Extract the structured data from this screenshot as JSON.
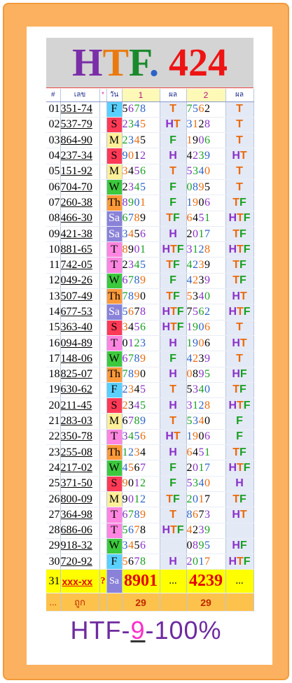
{
  "title": {
    "h": "H",
    "t": "T",
    "f": "F",
    "dot": ".",
    "num": "424"
  },
  "header": {
    "idx": "#",
    "code": "เลข",
    "star": "*",
    "day": "วัน",
    "col1": "1",
    "res1": "ผล",
    "col2": "2",
    "res2": "ผล"
  },
  "rows": [
    {
      "n": "01",
      "code": "351-74",
      "day": "F",
      "d1": "5",
      "n1": "678",
      "r1": "T",
      "n2": "7562",
      "d2": "",
      "r2": "T"
    },
    {
      "n": "02",
      "code": "537-79",
      "day": "S",
      "d1": "",
      "n1": "2345",
      "r1": "HT",
      "n2": "3128",
      "d2": "",
      "r2": "T"
    },
    {
      "n": "03",
      "code": "864-90",
      "day": "M",
      "d1": "",
      "n1": "2345",
      "r1": "F",
      "n2": "1906",
      "d2": "",
      "r2": "T"
    },
    {
      "n": "04",
      "code": "237-34",
      "day": "S",
      "d1": "",
      "n1": "9012",
      "r1": "H",
      "n2": "4239",
      "d2": "",
      "r2": "HT"
    },
    {
      "n": "05",
      "code": "151-92",
      "day": "M",
      "d1": "",
      "n1": "3456",
      "r1": "T",
      "n2": "5340",
      "d2": "",
      "r2": "T"
    },
    {
      "n": "06",
      "code": "704-70",
      "day": "W",
      "d1": "",
      "n1": "2345",
      "r1": "F",
      "n2": "0895",
      "d2": "",
      "r2": "T"
    },
    {
      "n": "07",
      "code": "260-38",
      "day": "Th",
      "d1": "",
      "n1": "8901",
      "r1": "F",
      "n2": "1906",
      "d2": "",
      "r2": "TF"
    },
    {
      "n": "08",
      "code": "466-30",
      "day": "Sa",
      "d1": "",
      "n1": "6789",
      "r1": "TF",
      "n2": "6451",
      "d2": "",
      "r2": "HTF"
    },
    {
      "n": "09",
      "code": "421-38",
      "day": "Sa",
      "d1": "",
      "n1": "3456",
      "r1": "H",
      "n2": "2017",
      "d2": "",
      "r2": "TF"
    },
    {
      "n": "10",
      "code": "881-65",
      "day": "T",
      "d1": "",
      "n1": "8901",
      "r1": "HTF",
      "n2": "3128",
      "d2": "",
      "r2": "HTF"
    },
    {
      "n": "11",
      "code": "742-05",
      "day": "T",
      "d1": "",
      "n1": "2345",
      "r1": "TF",
      "n2": "4239",
      "d2": "",
      "r2": "TF"
    },
    {
      "n": "12",
      "code": "049-26",
      "day": "W",
      "d1": "",
      "n1": "6789",
      "r1": "F",
      "n2": "4239",
      "d2": "",
      "r2": "TF"
    },
    {
      "n": "13",
      "code": "507-49",
      "day": "Th",
      "d1": "",
      "n1": "7890",
      "r1": "TF",
      "n2": "5340",
      "d2": "",
      "r2": "HT"
    },
    {
      "n": "14",
      "code": "677-53",
      "day": "Sa",
      "d1": "",
      "n1": "5678",
      "r1": "HTF",
      "n2": "7562",
      "d2": "",
      "r2": "HTF"
    },
    {
      "n": "15",
      "code": "363-40",
      "day": "S",
      "d1": "",
      "n1": "3456",
      "r1": "HTF",
      "n2": "1906",
      "d2": "",
      "r2": "T"
    },
    {
      "n": "16",
      "code": "094-89",
      "day": "T",
      "d1": "",
      "n1": "0123",
      "r1": "H",
      "n2": "1906",
      "d2": "",
      "r2": "HT"
    },
    {
      "n": "17",
      "code": "148-06",
      "day": "W",
      "d1": "",
      "n1": "6789",
      "r1": "F",
      "n2": "4239",
      "d2": "",
      "r2": "T"
    },
    {
      "n": "18",
      "code": "825-07",
      "day": "Th",
      "d1": "",
      "n1": "7890",
      "r1": "H",
      "n2": "0895",
      "d2": "",
      "r2": "HF"
    },
    {
      "n": "19",
      "code": "630-62",
      "day": "F",
      "d1": "",
      "n1": "2345",
      "r1": "T",
      "n2": "5340",
      "d2": "",
      "r2": "TF"
    },
    {
      "n": "20",
      "code": "211-45",
      "day": "S",
      "d1": "",
      "n1": "2345",
      "r1": "H",
      "n2": "3128",
      "d2": "",
      "r2": "HTF"
    },
    {
      "n": "21",
      "code": "283-03",
      "day": "M",
      "d1": "",
      "n1": "6789",
      "r1": "T",
      "n2": "5340",
      "d2": "",
      "r2": "F"
    },
    {
      "n": "22",
      "code": "350-78",
      "day": "T",
      "d1": "",
      "n1": "3456",
      "r1": "HT",
      "n2": "1906",
      "d2": "",
      "r2": "F"
    },
    {
      "n": "23",
      "code": "255-08",
      "day": "Th",
      "d1": "",
      "n1": "1234",
      "r1": "H",
      "n2": "6451",
      "d2": "",
      "r2": "TF"
    },
    {
      "n": "24",
      "code": "217-02",
      "day": "W",
      "d1": "",
      "n1": "4567",
      "r1": "F",
      "n2": "2017",
      "d2": "",
      "r2": "HTF"
    },
    {
      "n": "25",
      "code": "371-50",
      "day": "S",
      "d1": "",
      "n1": "9012",
      "r1": "F",
      "n2": "5340",
      "d2": "",
      "r2": "H"
    },
    {
      "n": "26",
      "code": "800-09",
      "day": "M",
      "d1": "",
      "n1": "9012",
      "r1": "TF",
      "n2": "2017",
      "d2": "",
      "r2": "TF"
    },
    {
      "n": "27",
      "code": "364-98",
      "day": "T",
      "d1": "",
      "n1": "6789",
      "r1": "T",
      "n2": "8673",
      "d2": "",
      "r2": "HT"
    },
    {
      "n": "28",
      "code": "686-06",
      "day": "T",
      "d1": "",
      "n1": "5678",
      "r1": "HTF",
      "n2": "4239",
      "d2": "",
      "r2": ""
    },
    {
      "n": "29",
      "code": "918-32",
      "day": "W",
      "d1": "",
      "n1": "3456",
      "r1": "",
      "n2": "0895",
      "d2": "",
      "r2": "HF"
    },
    {
      "n": "30",
      "code": "720-92",
      "day": "F",
      "d1": "",
      "n1": "5678",
      "r1": "H",
      "n2": "2017",
      "d2": "",
      "r2": "HTF"
    }
  ],
  "final": {
    "n": "31",
    "code": "xxx-xx",
    "q": "?",
    "day": "Sa",
    "n1": "8901",
    "r1": "...",
    "n2": "4239",
    "r2": "..."
  },
  "footer": {
    "a": "...",
    "b": "ถูก",
    "c1": "29",
    "c2": "29"
  },
  "bottom": {
    "pre": "HTF-",
    "nine": "9",
    "post": "-100%"
  }
}
